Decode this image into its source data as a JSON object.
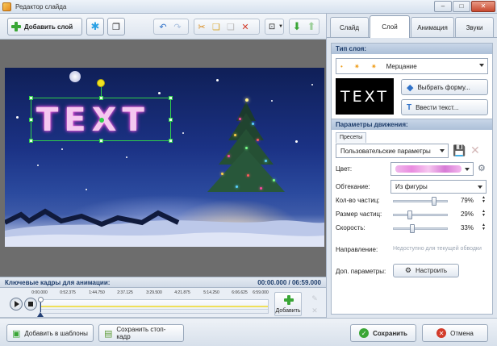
{
  "window": {
    "title": "Редактор слайда",
    "controls": {
      "minimize": "–",
      "maximize": "□",
      "close": "✕"
    }
  },
  "toolbar": {
    "add_layer": "Добавить слой",
    "icons": [
      "star-icon",
      "layers-icon",
      "undo-icon",
      "redo-icon",
      "cut-icon",
      "copy-icon",
      "paste-icon",
      "delete-icon",
      "align-icon",
      "move-down-icon",
      "move-up-icon"
    ]
  },
  "timeline": {
    "label": "Ключевые кадры для анимации:",
    "time": "00:00.000 / 06:59.000",
    "ticks": [
      "0:00.000",
      "0:52.375",
      "1:44.750",
      "2:37.125",
      "3:29.500",
      "4:21.875",
      "5:14.250",
      "6:06.625",
      "6:59.000"
    ],
    "add_label": "Добавить"
  },
  "tabs": [
    {
      "label": "Слайд",
      "active": false
    },
    {
      "label": "Слой",
      "active": true
    },
    {
      "label": "Анимация",
      "active": false
    },
    {
      "label": "Звуки",
      "active": false
    }
  ],
  "layer_type": {
    "header": "Тип слоя:",
    "selected": "Мерцание",
    "preview_text": "TEXT",
    "choose_shape": "Выбрать форму...",
    "enter_text": "Ввести текст..."
  },
  "motion": {
    "header": "Параметры движения:",
    "presets_tab": "Пресеты",
    "preset_value": "Пользовательские параметры",
    "color_label": "Цвет:",
    "flow_label": "Обтекание:",
    "flow_value": "Из фигуры",
    "count_label": "Кол-во частиц:",
    "count_value": "79%",
    "count_level": 0.79,
    "size_label": "Размер частиц:",
    "size_value": "29%",
    "size_level": 0.29,
    "speed_label": "Скорость:",
    "speed_value": "33%",
    "speed_level": 0.33,
    "direction_label": "Направление:",
    "direction_value": "Недоступно для текущей обводки",
    "extra_label": "Доп. параметры:",
    "configure": "Настроить"
  },
  "bottom": {
    "add_template": "Добавить в шаблоны",
    "save_frame": "Сохранить стоп-кадр",
    "save": "Сохранить",
    "cancel": "Отмена"
  },
  "colors": {
    "accent": "#1e3d6b",
    "selection": "#2fd04a",
    "save_icon": "#3aa636",
    "cancel_icon": "#d23b2a"
  }
}
